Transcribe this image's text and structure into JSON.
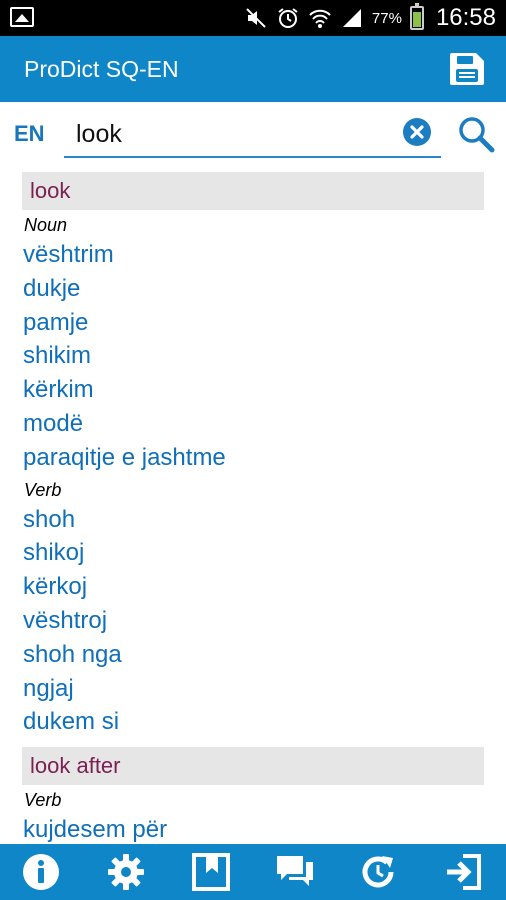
{
  "status_bar": {
    "battery": "77%",
    "time": "16:58"
  },
  "app_bar": {
    "title": "ProDict SQ-EN"
  },
  "search": {
    "language": "EN",
    "value": "look"
  },
  "entries": [
    {
      "headword": "look",
      "groups": [
        {
          "pos": "Noun",
          "translations": [
            "vështrim",
            "dukje",
            "pamje",
            "shikim",
            "kërkim",
            "modë",
            "paraqitje e jashtme"
          ]
        },
        {
          "pos": "Verb",
          "translations": [
            "shoh",
            "shikoj",
            "kërkoj",
            "vështroj",
            "shoh nga",
            "ngjaj",
            "dukem si"
          ]
        }
      ]
    },
    {
      "headword": "look after",
      "groups": [
        {
          "pos": "Verb",
          "translations": [
            "kujdesem për"
          ]
        }
      ]
    }
  ],
  "colors": {
    "primary": "#0f86c8",
    "headword": "#7a2052",
    "translation": "#0f6fb9",
    "header_bg": "#e6e6e6"
  },
  "bottom_bar": {
    "icons": [
      "info-icon",
      "settings-icon",
      "bookmark-icon",
      "chat-icon",
      "history-icon",
      "exit-icon"
    ]
  }
}
